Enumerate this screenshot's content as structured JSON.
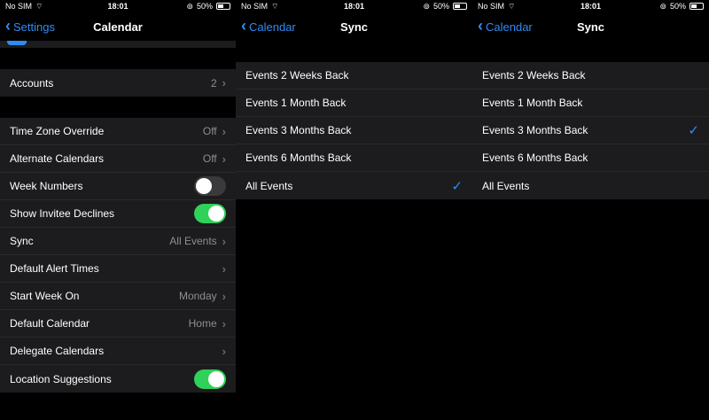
{
  "status": {
    "carrier": "No SIM",
    "time": "18:01",
    "battery": "50%"
  },
  "screen1": {
    "back_label": "Settings",
    "title": "Calendar",
    "accounts": {
      "label": "Accounts",
      "value": "2"
    },
    "rows": [
      {
        "label": "Time Zone Override",
        "value": "Off"
      },
      {
        "label": "Alternate Calendars",
        "value": "Off"
      },
      {
        "label": "Week Numbers",
        "toggle": "off"
      },
      {
        "label": "Show Invitee Declines",
        "toggle": "on"
      },
      {
        "label": "Sync",
        "value": "All Events"
      },
      {
        "label": "Default Alert Times",
        "value": ""
      },
      {
        "label": "Start Week On",
        "value": "Monday"
      },
      {
        "label": "Default Calendar",
        "value": "Home"
      },
      {
        "label": "Delegate Calendars",
        "value": ""
      },
      {
        "label": "Location Suggestions",
        "toggle": "on"
      }
    ]
  },
  "screen2": {
    "back_label": "Calendar",
    "title": "Sync",
    "options": [
      "Events 2 Weeks Back",
      "Events 1 Month Back",
      "Events 3 Months Back",
      "Events 6 Months Back",
      "All Events"
    ],
    "selected_index": 4
  },
  "screen3": {
    "back_label": "Calendar",
    "title": "Sync",
    "options": [
      "Events 2 Weeks Back",
      "Events 1 Month Back",
      "Events 3 Months Back",
      "Events 6 Months Back",
      "All Events"
    ],
    "selected_index": 2
  },
  "colors": {
    "accent": "#2f8cf3",
    "toggle_on": "#30d158",
    "cell_bg": "#1c1c1e"
  }
}
